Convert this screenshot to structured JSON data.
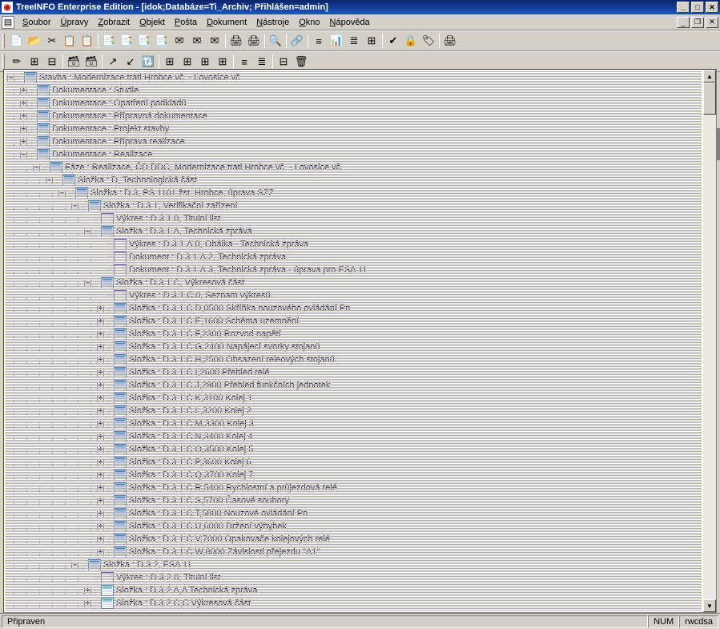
{
  "title": "TreeINFO Enterprise Edition - [idok;Databáze=Ti_Archiv; Přihlášen=admin]",
  "menus": [
    "Soubor",
    "Úpravy",
    "Zobrazit",
    "Objekt",
    "Pošta",
    "Dokument",
    "Nástroje",
    "Okno",
    "Nápověda"
  ],
  "status": {
    "ready": "Připraven",
    "num": "NUM",
    "mode": "rwcdsa"
  },
  "toolbar1": [
    "📄",
    "📂",
    "✂",
    "📋",
    "📋",
    "",
    "📑",
    "📑",
    "📑",
    "📑",
    "✉",
    "✉",
    "✉",
    "",
    "🖨",
    "🖨",
    "",
    "🔍",
    "",
    "🔗",
    "",
    "≡",
    "📊",
    "≣",
    "⊞",
    "",
    "✔",
    "🔒",
    "🏷",
    "",
    "🖨"
  ],
  "toolbar2": [
    "✏",
    "⊞",
    "⊟",
    "",
    "🗃",
    "🗃",
    "",
    "↗",
    "↙",
    "🔃",
    "",
    "⊞",
    "⊞",
    "⊞",
    "⊞",
    "",
    "≡",
    "≣",
    "",
    "⊟",
    "🗑"
  ],
  "tree": [
    {
      "d": 0,
      "e": "-",
      "i": "form",
      "t": "Stavba : Modernizace trati Hrobce vč. - Lovosice vč."
    },
    {
      "d": 1,
      "e": "+",
      "i": "form",
      "t": "Dokumentace : Studie"
    },
    {
      "d": 1,
      "e": "+",
      "i": "form",
      "t": "Dokumentace : Opatření podkladů"
    },
    {
      "d": 1,
      "e": "+",
      "i": "form",
      "t": "Dokumentace : Přípravná dokumentace"
    },
    {
      "d": 1,
      "e": "+",
      "i": "form",
      "t": "Dokumentace : Projekt stavby"
    },
    {
      "d": 1,
      "e": "+",
      "i": "form",
      "t": "Dokumentace : Příprava realizace"
    },
    {
      "d": 1,
      "e": "-",
      "i": "form",
      "t": "Dokumentace : Realizace"
    },
    {
      "d": 2,
      "e": "-",
      "i": "form",
      "t": "Fáze : Realizace, ČD DDC, Modernizace trati Hrobce vč. - Lovosice vč."
    },
    {
      "d": 3,
      "e": "-",
      "i": "form",
      "t": "Složka : D, Technologická část"
    },
    {
      "d": 4,
      "e": "-",
      "i": "form",
      "t": "Složka : D.3, PS 1101   žst. Hrobce, úprava SZZ"
    },
    {
      "d": 5,
      "e": "-",
      "i": "form",
      "t": "Složka : D.3.1, Verifikační zařízení"
    },
    {
      "d": 6,
      "e": " ",
      "i": "doc",
      "t": "Výkres : D.3.1.0, Titulní list"
    },
    {
      "d": 6,
      "e": "-",
      "i": "form",
      "t": "Složka : D.3.1.A, Technická zpráva"
    },
    {
      "d": 7,
      "e": " ",
      "i": "doc",
      "t": "Výkres : D.3.1.A.0, Obálka - Technická zpráva"
    },
    {
      "d": 7,
      "e": " ",
      "i": "doc",
      "t": "Dokument : D.3.1.A.2, Technická zpráva"
    },
    {
      "d": 7,
      "e": " ",
      "i": "doc",
      "t": "Dokument : D.3.1.A.3, Technická zpráva - úprava pro ESA 11"
    },
    {
      "d": 6,
      "e": "-",
      "i": "form",
      "t": "Složka : D.3.1.C, Výkresová část"
    },
    {
      "d": 7,
      "e": " ",
      "i": "doc",
      "t": "Výkres : D.3.1.C.0,  Seznam výkresů"
    },
    {
      "d": 7,
      "e": "+",
      "i": "form",
      "t": "Složka : D.3.1.C.D,0500   Skříňka nouzového ovládání Pn"
    },
    {
      "d": 7,
      "e": "+",
      "i": "form",
      "t": "Složka : D.3.1.C.E,1600   Schéma uzemnění"
    },
    {
      "d": 7,
      "e": "+",
      "i": "form",
      "t": "Složka : D.3.1.C.F,2300   Rozvod napětí"
    },
    {
      "d": 7,
      "e": "+",
      "i": "form",
      "t": "Složka : D.3.1.C.G,2400   Napájecí svorky stojanů"
    },
    {
      "d": 7,
      "e": "+",
      "i": "form",
      "t": "Složka : D.3.1.C.H,2500   Obsazení releových stojanů"
    },
    {
      "d": 7,
      "e": "+",
      "i": "form",
      "t": "Složka : D.3.1.C.I,2600   Přehled relé"
    },
    {
      "d": 7,
      "e": "+",
      "i": "form",
      "t": "Složka : D.3.1.C.J,2900   Přehled funkčních jednotek"
    },
    {
      "d": 7,
      "e": "+",
      "i": "form",
      "t": "Složka : D.3.1.C.K,3100   Kolej 1"
    },
    {
      "d": 7,
      "e": "+",
      "i": "form",
      "t": "Složka : D.3.1.C.L,3200   Kolej 2"
    },
    {
      "d": 7,
      "e": "+",
      "i": "form",
      "t": "Složka : D.3.1.C.M,3300   Kolej 3"
    },
    {
      "d": 7,
      "e": "+",
      "i": "form",
      "t": "Složka : D.3.1.C.N,3400   Kolej 4"
    },
    {
      "d": 7,
      "e": "+",
      "i": "form",
      "t": "Složka : D.3.1.C.O,3500   Kolej 5"
    },
    {
      "d": 7,
      "e": "+",
      "i": "form",
      "t": "Složka : D.3.1.C.P,3600   Kolej 6"
    },
    {
      "d": 7,
      "e": "+",
      "i": "form",
      "t": "Složka : D.3.1.C.Q,3700   Kolej 7"
    },
    {
      "d": 7,
      "e": "+",
      "i": "form",
      "t": "Složka : D.3.1.C.R,5400   Rychlostní a průjezdová relé"
    },
    {
      "d": 7,
      "e": "+",
      "i": "form",
      "t": "Složka : D.3.1.C.S,5700   Časové soubory"
    },
    {
      "d": 7,
      "e": "+",
      "i": "form",
      "t": "Složka : D.3.1.C.T,5800   Nouzové ovládání Pn"
    },
    {
      "d": 7,
      "e": "+",
      "i": "form",
      "t": "Složka : D.3.1.C.U,6000   Držení výhybek"
    },
    {
      "d": 7,
      "e": "+",
      "i": "form",
      "t": "Složka : D.3.1.C.V,7000   Opakovače kolejových relé"
    },
    {
      "d": 7,
      "e": "+",
      "i": "form",
      "t": "Složka : D.3.1.C.W,8000   Závislosti přejezdu \"A1\""
    },
    {
      "d": 5,
      "e": "-",
      "i": "form",
      "t": "Složka : D.3.2, ESA 11"
    },
    {
      "d": 6,
      "e": " ",
      "i": "doc",
      "t": "Výkres : D.3.2.0, Titulní list"
    },
    {
      "d": 6,
      "e": "+",
      "i": "form",
      "t": "Složka : D.3.2.A,A   Technická zpráva"
    },
    {
      "d": 6,
      "e": "+",
      "i": "form",
      "t": "Složka : D.3.2.C,C   Výkresová část"
    }
  ]
}
